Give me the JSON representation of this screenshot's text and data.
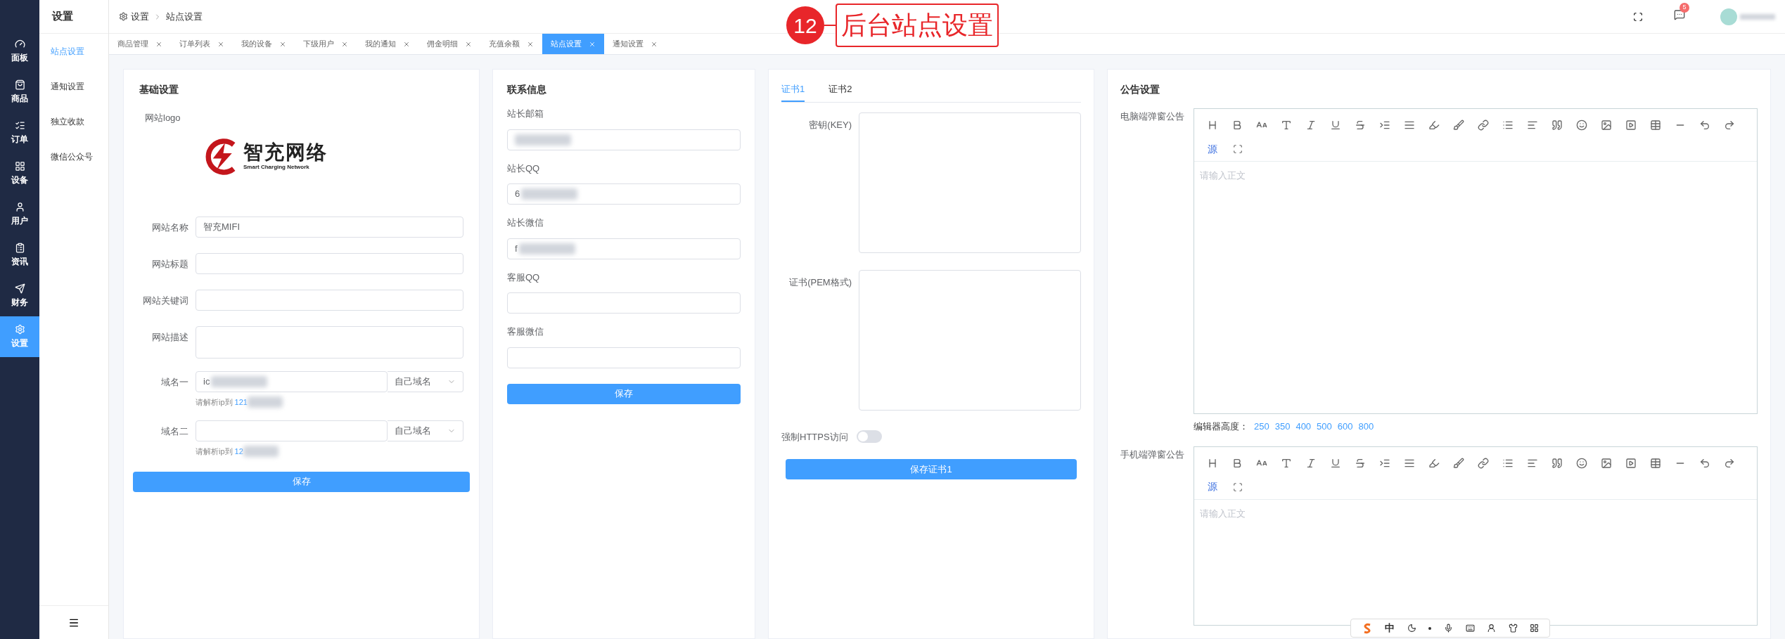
{
  "nav": [
    {
      "label": "面板",
      "selected": false
    },
    {
      "label": "商品",
      "selected": false
    },
    {
      "label": "订单",
      "selected": false
    },
    {
      "label": "设备",
      "selected": false
    },
    {
      "label": "用户",
      "selected": false
    },
    {
      "label": "资讯",
      "selected": false
    },
    {
      "label": "财务",
      "selected": false
    },
    {
      "label": "设置",
      "selected": true
    }
  ],
  "subnav": {
    "title": "设置",
    "items": [
      {
        "label": "站点设置",
        "selected": true
      },
      {
        "label": "通知设置",
        "selected": false
      },
      {
        "label": "独立收款",
        "selected": false
      },
      {
        "label": "微信公众号",
        "selected": false
      }
    ]
  },
  "breadcrumb": [
    "设置",
    "站点设置"
  ],
  "tabs": [
    {
      "label": "商品管理",
      "selected": false
    },
    {
      "label": "订单列表",
      "selected": false
    },
    {
      "label": "我的设备",
      "selected": false
    },
    {
      "label": "下级用户",
      "selected": false
    },
    {
      "label": "我的通知",
      "selected": false
    },
    {
      "label": "佣金明细",
      "selected": false
    },
    {
      "label": "充值余额",
      "selected": false
    },
    {
      "label": "站点设置",
      "selected": true
    },
    {
      "label": "通知设置",
      "selected": false
    }
  ],
  "header": {
    "message_badge": "5"
  },
  "annotation": {
    "number": "12",
    "text": "后台站点设置"
  },
  "basic": {
    "title": "基础设置",
    "logo_label": "网站logo",
    "logo": {
      "name": "智充网络",
      "tagline": "Smart Charging Network"
    },
    "fields": [
      {
        "kind": "input",
        "label": "网站名称",
        "value": "智充MIFI",
        "blurred": false
      },
      {
        "kind": "input",
        "label": "网站标题",
        "blurred": false
      },
      {
        "kind": "input",
        "label": "网站关键词",
        "blurred": false
      },
      {
        "kind": "textarea",
        "label": "网站描述",
        "blurred": false
      },
      {
        "kind": "domain",
        "label": "域名一",
        "value": "ic",
        "blurred": true,
        "select": "自己域名",
        "hint": "请解析ip到",
        "hint_ip": "121",
        "hint_blurred": true
      },
      {
        "kind": "domain",
        "label": "域名二",
        "blurred": false,
        "select": "自己域名",
        "hint": "请解析ip到",
        "hint_ip": "12",
        "hint_blurred": true
      }
    ],
    "save": "保存"
  },
  "contact": {
    "title": "联系信息",
    "fields": [
      {
        "label": "站长邮箱",
        "blurred": true
      },
      {
        "label": "站长QQ",
        "value": "6",
        "blurred": true
      },
      {
        "label": "站长微信",
        "value": "f",
        "blurred": true
      },
      {
        "label": "客服QQ",
        "blurred": false
      },
      {
        "label": "客服微信",
        "blurred": false
      }
    ],
    "save": "保存"
  },
  "cert": {
    "tabs": [
      {
        "label": "证书1",
        "selected": true
      },
      {
        "label": "证书2",
        "selected": false
      }
    ],
    "fields": [
      {
        "label": "密钥(KEY)"
      },
      {
        "label": "证书(PEM格式)"
      }
    ],
    "https": {
      "label": "强制HTTPS访问",
      "on": false
    },
    "save": "保存证书1"
  },
  "notice": {
    "title": "公告设置",
    "editors": [
      {
        "label": "电脑端弹窗公告",
        "source_button": "源",
        "placeholder": "请输入正文",
        "height_label": "编辑器高度：",
        "heights": [
          "250",
          "350",
          "400",
          "500",
          "600",
          "800"
        ]
      },
      {
        "label": "手机端弹窗公告",
        "source_button": "源",
        "placeholder": "请输入正文"
      }
    ]
  },
  "ime": {
    "mode": "中"
  }
}
